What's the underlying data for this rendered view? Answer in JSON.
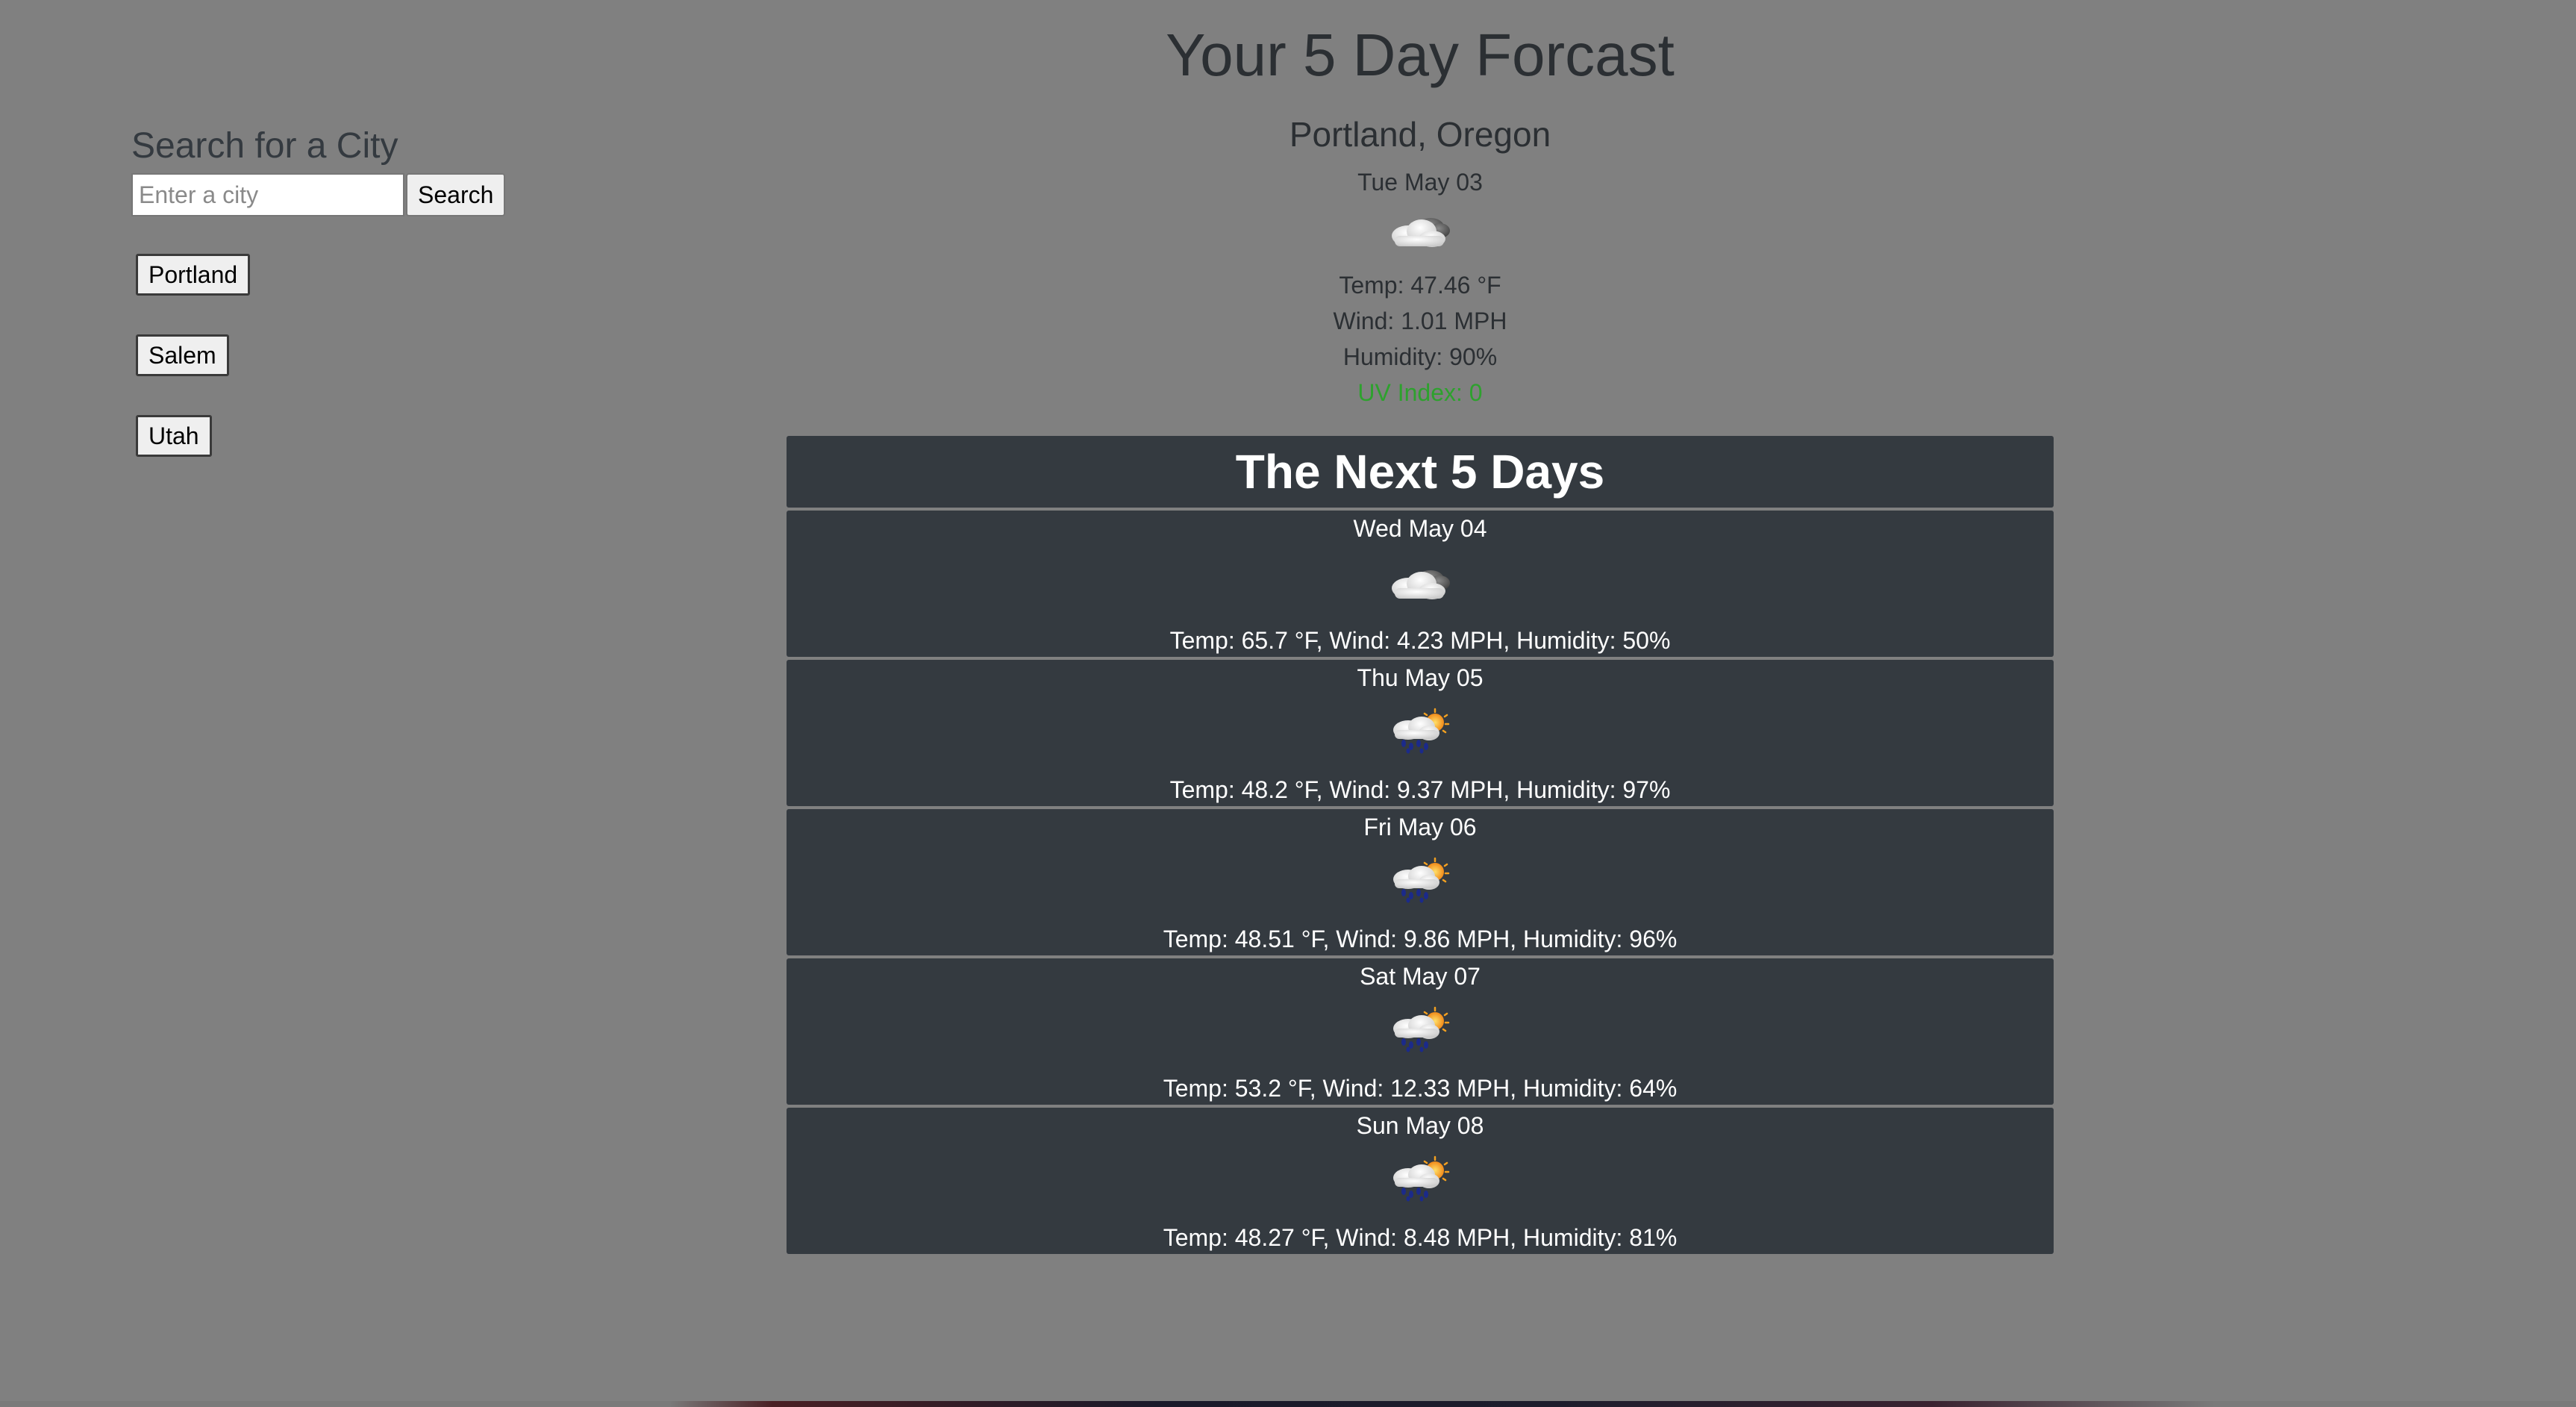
{
  "sidebar": {
    "title": "Search for a City",
    "search_placeholder": "Enter a city",
    "search_button": "Search",
    "history": [
      "Portland",
      "Salem",
      "Utah"
    ]
  },
  "main": {
    "title": "Your 5 Day Forcast",
    "city": "Portland, Oregon",
    "today": {
      "date": "Tue May 03",
      "icon": "partly-cloudy-night-icon",
      "temp": "Temp: 47.46 °F",
      "wind": "Wind: 1.01 MPH",
      "humidity": "Humidity: 90%",
      "uv": "UV Index: 0",
      "uv_color": "#2ea12e"
    },
    "forecast_title": "The Next 5 Days",
    "forecast": [
      {
        "date": "Wed May 04",
        "icon": "partly-cloudy-night-icon",
        "details": "Temp: 65.7 °F, Wind: 4.23 MPH, Humidity: 50%"
      },
      {
        "date": "Thu May 05",
        "icon": "rain-sun-icon",
        "details": "Temp: 48.2 °F, Wind: 9.37 MPH, Humidity: 97%"
      },
      {
        "date": "Fri May 06",
        "icon": "rain-sun-icon",
        "details": "Temp: 48.51 °F, Wind: 9.86 MPH, Humidity: 96%"
      },
      {
        "date": "Sat May 07",
        "icon": "rain-sun-icon",
        "details": "Temp: 53.2 °F, Wind: 12.33 MPH, Humidity: 64%"
      },
      {
        "date": "Sun May 08",
        "icon": "rain-sun-icon",
        "details": "Temp: 48.27 °F, Wind: 8.48 MPH, Humidity: 81%"
      }
    ]
  },
  "colors": {
    "background": "#808080",
    "card": "#343a40",
    "uv_green": "#2ea12e"
  }
}
